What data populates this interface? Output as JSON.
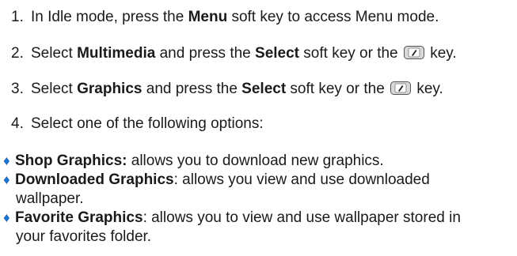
{
  "steps": [
    {
      "num": "1.",
      "pre": "In Idle mode, press the ",
      "bold1": "Menu",
      "mid": " soft key to access Menu mode."
    },
    {
      "num": "2.",
      "pre": "Select ",
      "bold1": "Multimedia",
      "mid": " and press the ",
      "bold2": "Select",
      "post": " soft key or the ",
      "end": " key."
    },
    {
      "num": "3.",
      "pre": "Select ",
      "bold1": "Graphics",
      "mid": " and press the ",
      "bold2": "Select",
      "post": " soft key or the ",
      "end": " key."
    },
    {
      "num": "4.",
      "text": "Select one of the following options:"
    }
  ],
  "options": [
    {
      "label": "Shop Graphics:",
      "desc": " allows you to download new graphics."
    },
    {
      "label": "Downloaded Graphics",
      "desc": ": allows you view and use downloaded",
      "cont": "wallpaper."
    },
    {
      "label": "Favorite Graphics",
      "desc": ": allows you to view and use wallpaper stored in",
      "cont": "your favorites folder."
    }
  ],
  "bullet_symbol": "♦",
  "bullet_color": "#1a6fd1",
  "key_icon": "ok-key-icon"
}
